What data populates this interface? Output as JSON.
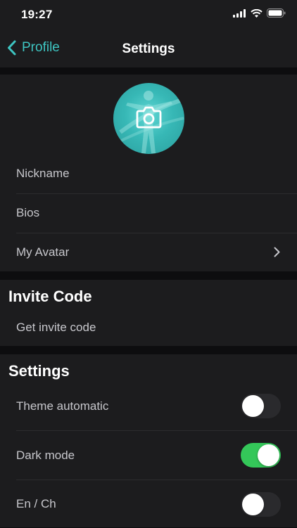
{
  "status": {
    "time": "19:27"
  },
  "nav": {
    "back_label": "Profile",
    "title": "Settings"
  },
  "profile": {
    "items": [
      {
        "label": "Nickname"
      },
      {
        "label": "Bios"
      },
      {
        "label": "My Avatar"
      }
    ]
  },
  "invite": {
    "title": "Invite Code",
    "item_label": "Get invite code"
  },
  "settings": {
    "title": "Settings",
    "toggles": [
      {
        "label": "Theme automatic",
        "on": false
      },
      {
        "label": "Dark mode",
        "on": true
      },
      {
        "label": "En / Ch",
        "on": false
      }
    ]
  },
  "colors": {
    "accent": "#3ec5c2",
    "toggle_on": "#34c759",
    "background": "#1c1c1e"
  },
  "icons": [
    "signal-icon",
    "wifi-icon",
    "battery-icon",
    "chevron-left-icon",
    "camera-icon",
    "chevron-right-icon"
  ]
}
